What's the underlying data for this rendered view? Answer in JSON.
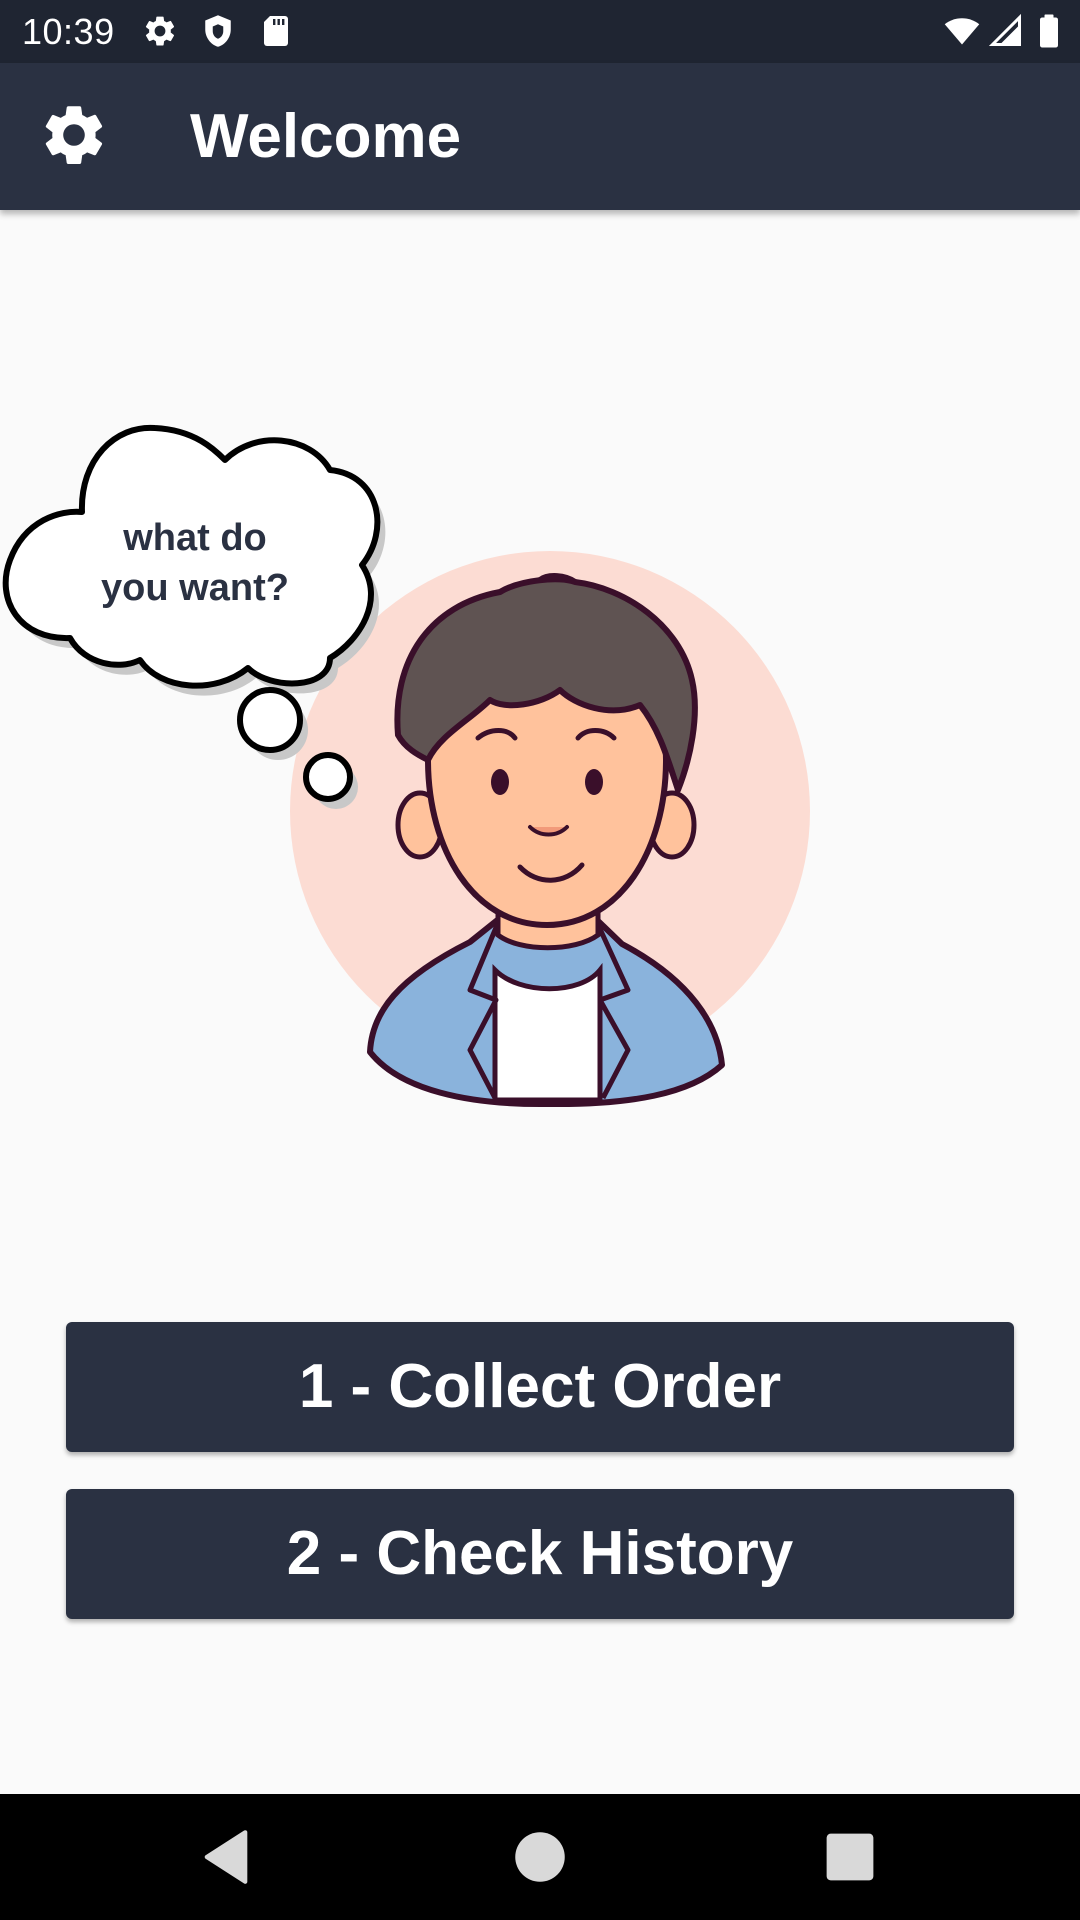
{
  "status_bar": {
    "time": "10:39",
    "left_icons": [
      "settings-gear-icon",
      "shield-icon",
      "sd-card-icon"
    ],
    "right_icons": [
      "wifi-icon",
      "cell-signal-icon",
      "battery-icon"
    ]
  },
  "app_bar": {
    "title": "Welcome",
    "settings_icon": "gear-icon"
  },
  "illustration": {
    "thought_bubble_text_line1": "what do",
    "thought_bubble_text_line2": "you want?"
  },
  "actions": {
    "collect_order_label": "1 - Collect Order",
    "check_history_label": "2 - Check History"
  },
  "nav_bar": {
    "back_icon": "back-triangle-icon",
    "home_icon": "home-circle-icon",
    "recents_icon": "recents-square-icon"
  },
  "colors": {
    "status_bar": "#1f2532",
    "app_bar": "#2a3142",
    "background": "#fafafa",
    "button": "#2a3142",
    "button_text": "#ffffff",
    "avatar_circle": "#fcdcd3",
    "skin": "#ffc29c",
    "hair": "#5f5352",
    "jacket": "#8ab3dc",
    "outline": "#3a0f2a"
  }
}
